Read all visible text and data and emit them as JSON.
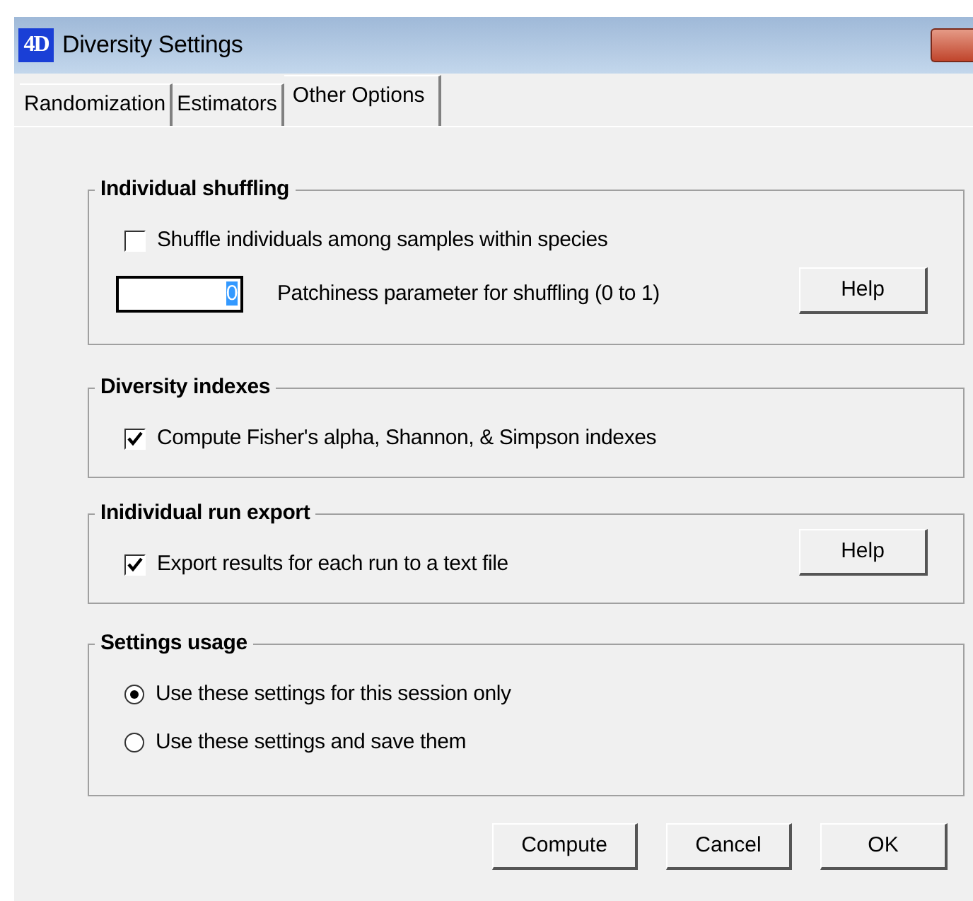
{
  "window": {
    "icon_text": "4D",
    "title": "Diversity Settings"
  },
  "tabs": [
    {
      "label": "Randomization",
      "selected": false
    },
    {
      "label": "Estimators",
      "selected": false
    },
    {
      "label": "Other Options",
      "selected": true
    }
  ],
  "groups": [
    {
      "title": "Individual shuffling",
      "help": "Help",
      "items": [
        {
          "kind": "checkbox",
          "label": "Shuffle individuals among samples within species",
          "checked": false
        },
        {
          "kind": "field",
          "value": "0",
          "label": "Patchiness parameter for shuffling (0 to 1)"
        }
      ]
    },
    {
      "title": "Diversity indexes",
      "items": [
        {
          "kind": "checkbox",
          "label": "Compute Fisher's alpha, Shannon, & Simpson indexes",
          "checked": true
        }
      ]
    },
    {
      "title": "Inidividual run export",
      "help": "Help",
      "items": [
        {
          "kind": "checkbox",
          "label": "Export results for each run to a text file",
          "checked": true
        }
      ]
    },
    {
      "title": "Settings usage",
      "items": [
        {
          "kind": "radio",
          "label": "Use these settings for this session only",
          "selected": true
        },
        {
          "kind": "radio",
          "label": "Use these settings and save them",
          "selected": false
        }
      ]
    }
  ],
  "buttons": [
    "Compute",
    "Cancel",
    "OK"
  ]
}
